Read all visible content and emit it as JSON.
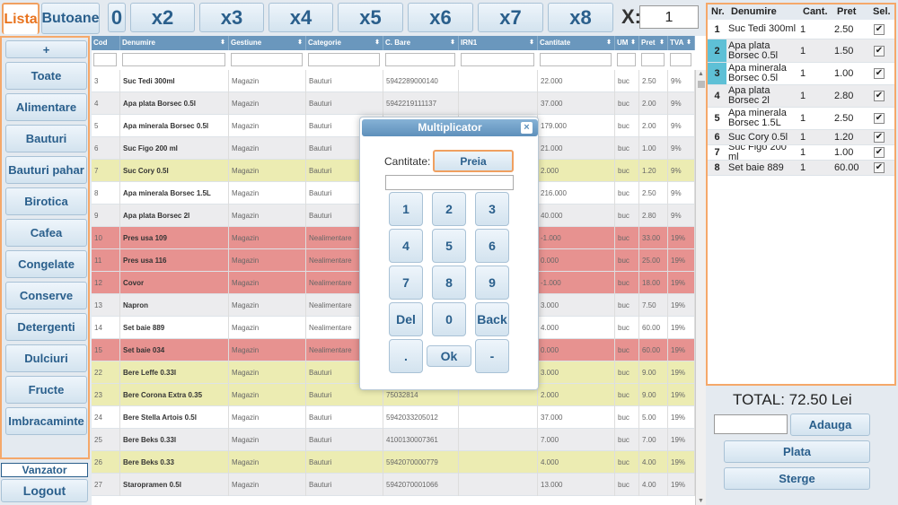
{
  "tabs": [
    {
      "label": "Lista",
      "active": true
    },
    {
      "label": "Butoane",
      "active": false
    }
  ],
  "multipliers": [
    "0",
    "x2",
    "x3",
    "x4",
    "x5",
    "x6",
    "x7",
    "x8"
  ],
  "x_label": "X:",
  "x_value": "1",
  "categories": {
    "add_label": "+",
    "items": [
      "Toate",
      "Alimentare",
      "Bauturi",
      "Bauturi pahar",
      "Birotica",
      "Cafea",
      "Congelate",
      "Conserve",
      "Detergenti",
      "Dulciuri",
      "Fructe",
      "Imbracaminte"
    ]
  },
  "vanzator_label": "Vanzator",
  "logout_label": "Logout",
  "grid": {
    "columns": [
      "Cod",
      "Denumire",
      "Gestiune",
      "Categorie",
      "C. Bare",
      "IRN1",
      "Cantitate",
      "UM",
      "Pret",
      "TVA"
    ],
    "rows": [
      {
        "cod": "3",
        "denumire": "Suc Tedi 300ml",
        "gestiune": "Magazin",
        "categorie": "Bauturi",
        "cbare": "5942289000140",
        "irn1": "",
        "cantitate": "22.000",
        "um": "buc",
        "pret": "2.50",
        "tva": "9%",
        "color": "white"
      },
      {
        "cod": "4",
        "denumire": "Apa plata Borsec 0.5l",
        "gestiune": "Magazin",
        "categorie": "Bauturi",
        "cbare": "5942219111137",
        "irn1": "",
        "cantitate": "37.000",
        "um": "buc",
        "pret": "2.00",
        "tva": "9%",
        "color": "gray"
      },
      {
        "cod": "5",
        "denumire": "Apa minerala Borsec 0.5l",
        "gestiune": "Magazin",
        "categorie": "Bauturi",
        "cbare": "",
        "irn1": "",
        "cantitate": "179.000",
        "um": "buc",
        "pret": "2.00",
        "tva": "9%",
        "color": "white"
      },
      {
        "cod": "6",
        "denumire": "Suc Figo 200 ml",
        "gestiune": "Magazin",
        "categorie": "Bauturi",
        "cbare": "",
        "irn1": "",
        "cantitate": "21.000",
        "um": "buc",
        "pret": "1.00",
        "tva": "9%",
        "color": "gray"
      },
      {
        "cod": "7",
        "denumire": "Suc Cory 0.5l",
        "gestiune": "Magazin",
        "categorie": "Bauturi",
        "cbare": "",
        "irn1": "",
        "cantitate": "2.000",
        "um": "buc",
        "pret": "1.20",
        "tva": "9%",
        "color": "yellow"
      },
      {
        "cod": "8",
        "denumire": "Apa minerala Borsec 1.5L",
        "gestiune": "Magazin",
        "categorie": "Bauturi",
        "cbare": "",
        "irn1": "",
        "cantitate": "216.000",
        "um": "buc",
        "pret": "2.50",
        "tva": "9%",
        "color": "white"
      },
      {
        "cod": "9",
        "denumire": "Apa plata Borsec 2l",
        "gestiune": "Magazin",
        "categorie": "Bauturi",
        "cbare": "",
        "irn1": "",
        "cantitate": "40.000",
        "um": "buc",
        "pret": "2.80",
        "tva": "9%",
        "color": "gray"
      },
      {
        "cod": "10",
        "denumire": "Pres usa 109",
        "gestiune": "Magazin",
        "categorie": "Nealimentare",
        "cbare": "",
        "irn1": "",
        "cantitate": "-1.000",
        "um": "buc",
        "pret": "33.00",
        "tva": "19%",
        "color": "red"
      },
      {
        "cod": "11",
        "denumire": "Pres usa 116",
        "gestiune": "Magazin",
        "categorie": "Nealimentare",
        "cbare": "",
        "irn1": "",
        "cantitate": "0.000",
        "um": "buc",
        "pret": "25.00",
        "tva": "19%",
        "color": "red"
      },
      {
        "cod": "12",
        "denumire": "Covor",
        "gestiune": "Magazin",
        "categorie": "Nealimentare",
        "cbare": "",
        "irn1": "",
        "cantitate": "-1.000",
        "um": "buc",
        "pret": "18.00",
        "tva": "19%",
        "color": "red"
      },
      {
        "cod": "13",
        "denumire": "Napron",
        "gestiune": "Magazin",
        "categorie": "Nealimentare",
        "cbare": "",
        "irn1": "",
        "cantitate": "3.000",
        "um": "buc",
        "pret": "7.50",
        "tva": "19%",
        "color": "gray"
      },
      {
        "cod": "14",
        "denumire": "Set baie 889",
        "gestiune": "Magazin",
        "categorie": "Nealimentare",
        "cbare": "",
        "irn1": "",
        "cantitate": "4.000",
        "um": "buc",
        "pret": "60.00",
        "tva": "19%",
        "color": "white"
      },
      {
        "cod": "15",
        "denumire": "Set baie 034",
        "gestiune": "Magazin",
        "categorie": "Nealimentare",
        "cbare": "",
        "irn1": "",
        "cantitate": "0.000",
        "um": "buc",
        "pret": "60.00",
        "tva": "19%",
        "color": "red"
      },
      {
        "cod": "22",
        "denumire": "Bere Leffe 0.33l",
        "gestiune": "Magazin",
        "categorie": "Bauturi",
        "cbare": "",
        "irn1": "",
        "cantitate": "3.000",
        "um": "buc",
        "pret": "9.00",
        "tva": "19%",
        "color": "yellow"
      },
      {
        "cod": "23",
        "denumire": "Bere Corona Extra 0.35",
        "gestiune": "Magazin",
        "categorie": "Bauturi",
        "cbare": "75032814",
        "irn1": "",
        "cantitate": "2.000",
        "um": "buc",
        "pret": "9.00",
        "tva": "19%",
        "color": "yellow"
      },
      {
        "cod": "24",
        "denumire": "Bere Stella Artois 0.5l",
        "gestiune": "Magazin",
        "categorie": "Bauturi",
        "cbare": "5942033205012",
        "irn1": "",
        "cantitate": "37.000",
        "um": "buc",
        "pret": "5.00",
        "tva": "19%",
        "color": "white"
      },
      {
        "cod": "25",
        "denumire": "Bere Beks 0.33l",
        "gestiune": "Magazin",
        "categorie": "Bauturi",
        "cbare": "4100130007361",
        "irn1": "",
        "cantitate": "7.000",
        "um": "buc",
        "pret": "7.00",
        "tva": "19%",
        "color": "gray"
      },
      {
        "cod": "26",
        "denumire": "Bere Beks 0.33",
        "gestiune": "Magazin",
        "categorie": "Bauturi",
        "cbare": "5942070000779",
        "irn1": "",
        "cantitate": "4.000",
        "um": "buc",
        "pret": "4.00",
        "tva": "19%",
        "color": "yellow"
      },
      {
        "cod": "27",
        "denumire": "Staropramen 0.5l",
        "gestiune": "Magazin",
        "categorie": "Bauturi",
        "cbare": "5942070001066",
        "irn1": "",
        "cantitate": "13.000",
        "um": "buc",
        "pret": "4.00",
        "tva": "19%",
        "color": "gray"
      }
    ]
  },
  "dialog": {
    "title": "Multiplicator",
    "close_label": "×",
    "cantitate_label": "Cantitate:",
    "preia_label": "Preia",
    "input_value": "",
    "keys": [
      [
        "1",
        "2",
        "3"
      ],
      [
        "4",
        "5",
        "6"
      ],
      [
        "7",
        "8",
        "9"
      ],
      [
        "Del",
        "0",
        "Back"
      ],
      [
        ".",
        "Ok",
        "-"
      ]
    ]
  },
  "receipt": {
    "columns": [
      "Nr.",
      "Denumire",
      "Cant.",
      "Pret",
      "Sel."
    ],
    "rows": [
      {
        "nr": "1",
        "denumire": "Suc Tedi 300ml",
        "cant": "1",
        "pret": "2.50",
        "checked": true
      },
      {
        "nr": "2",
        "denumire": "Apa plata Borsec 0.5l",
        "cant": "1",
        "pret": "1.50",
        "checked": true
      },
      {
        "nr": "3",
        "denumire": "Apa minerala Borsec 0.5l",
        "cant": "1",
        "pret": "1.00",
        "checked": true
      },
      {
        "nr": "4",
        "denumire": "Apa plata Borsec 2l",
        "cant": "1",
        "pret": "2.80",
        "checked": true
      },
      {
        "nr": "5",
        "denumire": "Apa minerala Borsec 1.5L",
        "cant": "1",
        "pret": "2.50",
        "checked": true
      },
      {
        "nr": "6",
        "denumire": "Suc Cory 0.5l",
        "cant": "1",
        "pret": "1.20",
        "checked": true
      },
      {
        "nr": "7",
        "denumire": "Suc Figo 200 ml",
        "cant": "1",
        "pret": "1.00",
        "checked": true
      },
      {
        "nr": "8",
        "denumire": "Set baie 889",
        "cant": "1",
        "pret": "60.00",
        "checked": true
      }
    ]
  },
  "total_label": "TOTAL: 72.50 Lei",
  "amount_value": "",
  "adauga_label": "Adauga",
  "plata_label": "Plata",
  "sterge_label": "Sterge",
  "colors": {
    "accent_orange": "#e8731e",
    "header_blue": "#6a97bd",
    "row_yellow": "#ececb2",
    "row_red": "#e79290",
    "row_gray": "#ececee",
    "selected_nr": "#5ec0d6"
  }
}
